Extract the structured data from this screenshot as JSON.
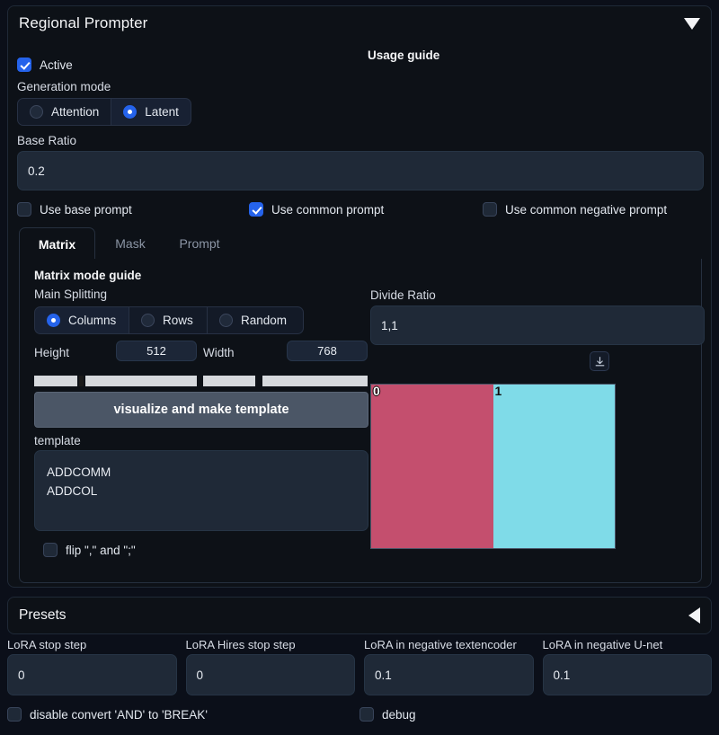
{
  "panel": {
    "title": "Regional Prompter",
    "collapse_icon": "triangle-down-icon",
    "usage_guide": "Usage guide"
  },
  "active": {
    "label": "Active",
    "checked": true
  },
  "generation_mode": {
    "label": "Generation mode",
    "options": [
      {
        "label": "Attention",
        "selected": false
      },
      {
        "label": "Latent",
        "selected": true
      }
    ]
  },
  "base_ratio": {
    "label": "Base Ratio",
    "value": "0.2"
  },
  "prompt_checks": [
    {
      "label": "Use base prompt",
      "checked": false
    },
    {
      "label": "Use common prompt",
      "checked": true
    },
    {
      "label": "Use common negative prompt",
      "checked": false
    }
  ],
  "tabs": [
    {
      "label": "Matrix",
      "active": true
    },
    {
      "label": "Mask",
      "active": false
    },
    {
      "label": "Prompt",
      "active": false
    }
  ],
  "matrix": {
    "guide_label": "Matrix mode guide",
    "main_splitting_label": "Main Splitting",
    "splitting_options": [
      {
        "label": "Columns",
        "selected": true
      },
      {
        "label": "Rows",
        "selected": false
      },
      {
        "label": "Random",
        "selected": false
      }
    ],
    "height": {
      "label": "Height",
      "value": "512"
    },
    "width": {
      "label": "Width",
      "value": "768"
    },
    "visualize_button": "visualize and make template",
    "template": {
      "label": "template",
      "value": "ADDCOMM\nADDCOL"
    },
    "flip": {
      "label": "flip \",\" and \";\"",
      "checked": false
    },
    "divide_ratio": {
      "label": "Divide Ratio",
      "value": "1,1"
    },
    "download_icon": "download-icon",
    "visualization": {
      "regions": [
        {
          "index": "0",
          "color": "#c44f6e",
          "width_pct": 50
        },
        {
          "index": "1",
          "color": "#7fdbe8",
          "width_pct": 50
        }
      ]
    }
  },
  "presets": {
    "title": "Presets",
    "collapse_icon": "triangle-left-icon"
  },
  "lora_fields": [
    {
      "label": "LoRA stop step",
      "value": "0"
    },
    {
      "label": "LoRA Hires stop step",
      "value": "0"
    },
    {
      "label": "LoRA in negative textencoder",
      "value": "0.1"
    },
    {
      "label": "LoRA in negative U-net",
      "value": "0.1"
    }
  ],
  "bottom_checks": [
    {
      "label": "disable convert 'AND' to 'BREAK'",
      "checked": false
    },
    {
      "label": "debug",
      "checked": false
    }
  ]
}
